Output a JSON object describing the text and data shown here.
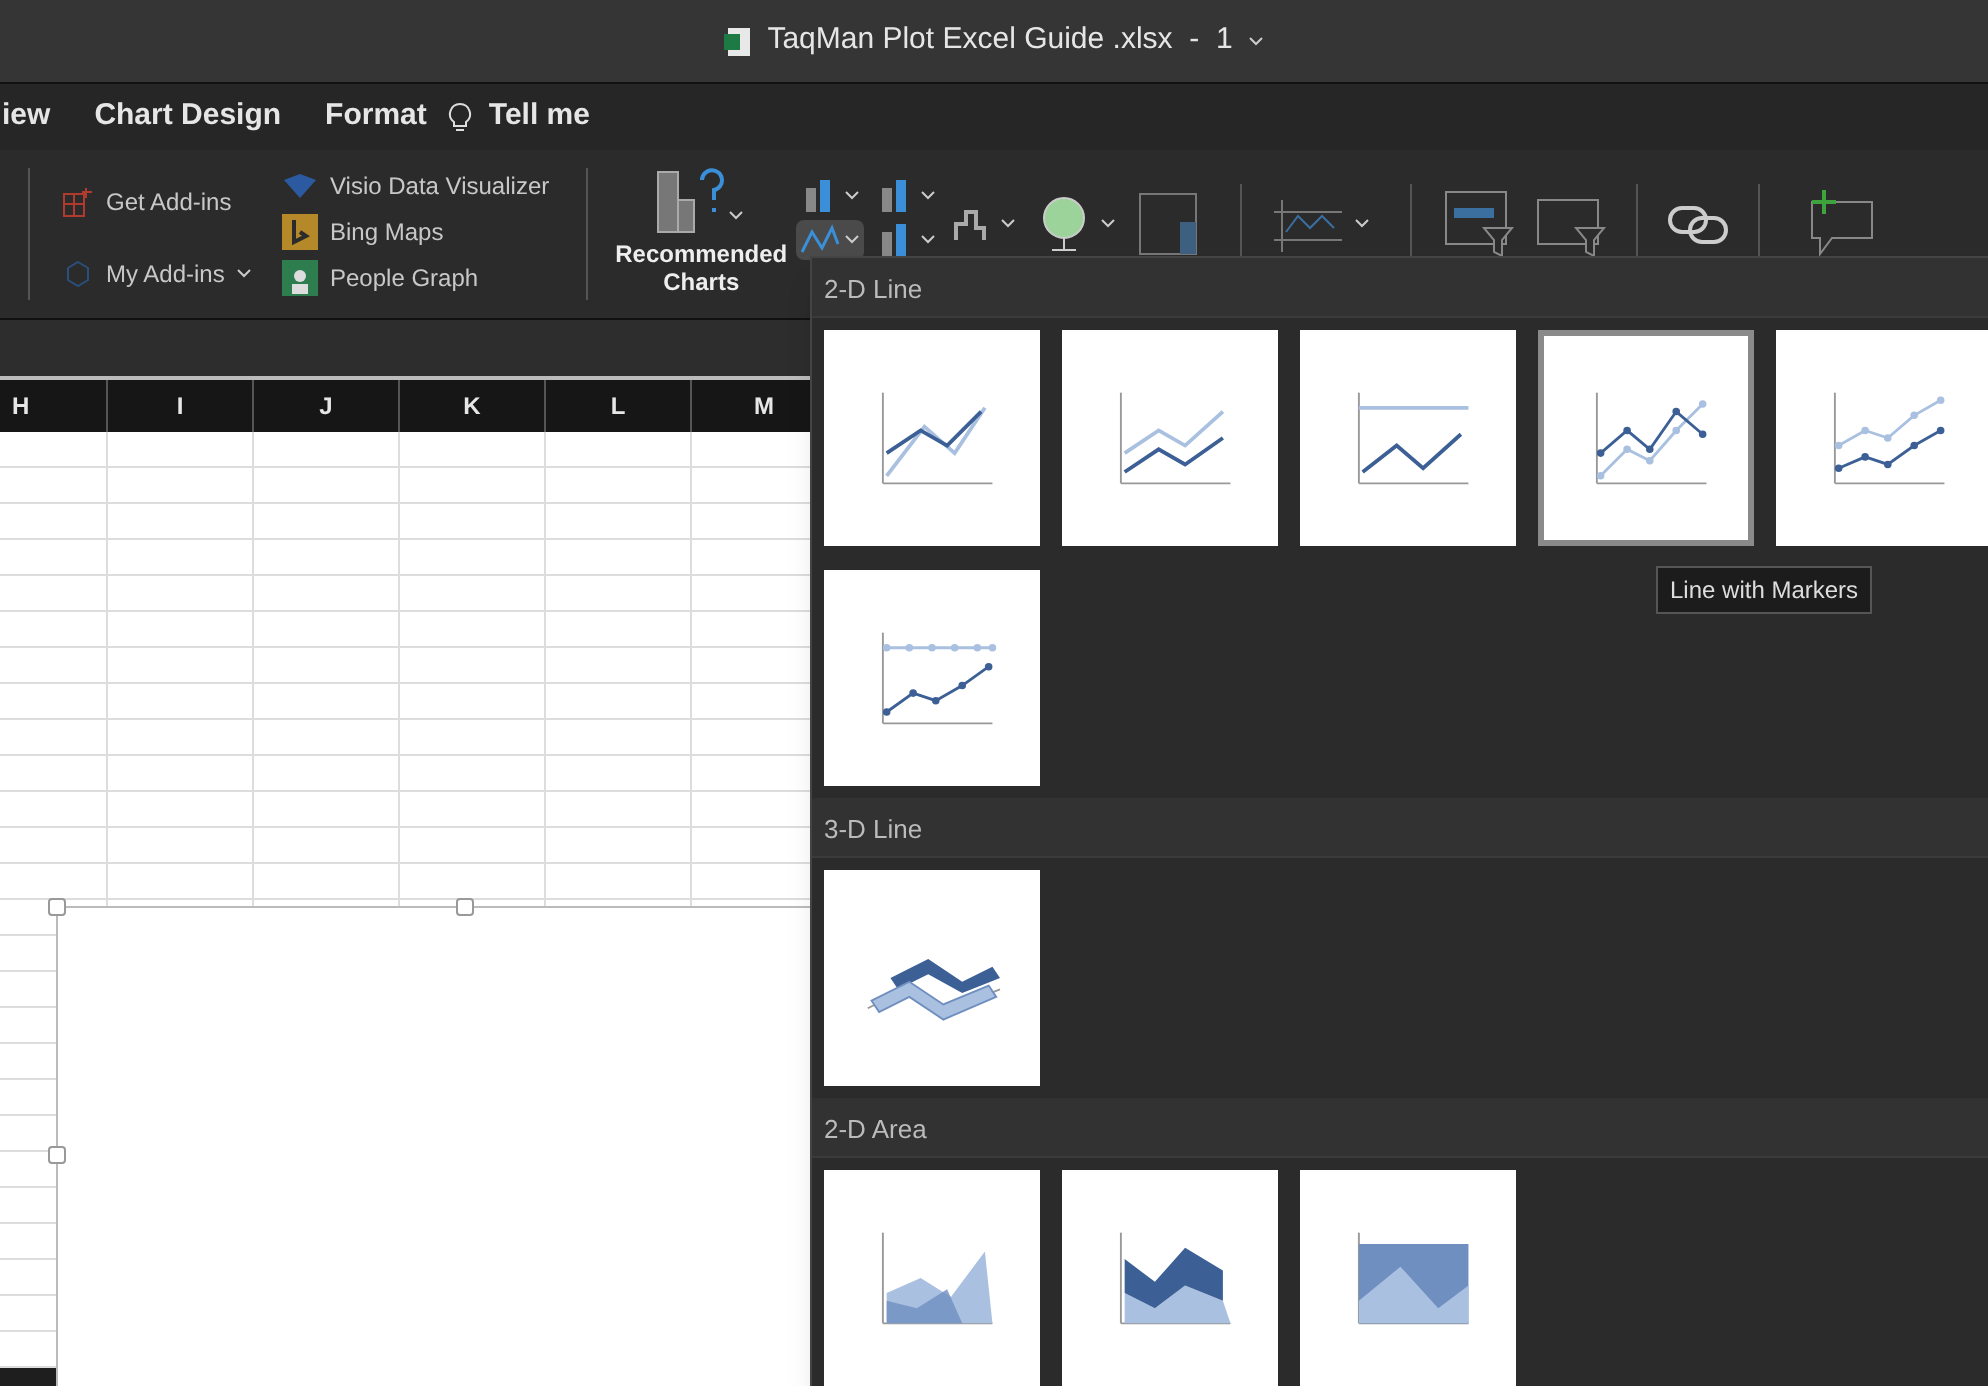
{
  "window": {
    "title": "TaqMan Plot Excel Guide .xlsx  -  1"
  },
  "tabs": [
    {
      "label": "iew",
      "selected": false
    },
    {
      "label": "Chart Design",
      "selected": false
    },
    {
      "label": "Format",
      "selected": false
    }
  ],
  "tell_me": {
    "label": "Tell me"
  },
  "addins": {
    "get": "Get Add-ins",
    "my": "My Add-ins",
    "visio": "Visio Data Visualizer",
    "bing": "Bing Maps",
    "people": "People Graph"
  },
  "recommended": {
    "label": "Recommended Charts"
  },
  "columns": [
    "H",
    "I",
    "J",
    "K",
    "L",
    "M"
  ],
  "gallery": {
    "sections": [
      {
        "title": "2-D Line",
        "items": [
          {
            "kind": "line",
            "selected": false
          },
          {
            "kind": "stacked-line",
            "selected": false
          },
          {
            "kind": "percent-line",
            "selected": false
          },
          {
            "kind": "line-markers",
            "selected": true
          },
          {
            "kind": "stacked-markers",
            "selected": false
          },
          {
            "kind": "percent-markers",
            "selected": false
          }
        ]
      },
      {
        "title": "3-D Line",
        "items": [
          {
            "kind": "line-3d",
            "selected": false
          }
        ]
      },
      {
        "title": "2-D Area",
        "items": [
          {
            "kind": "area",
            "selected": false
          },
          {
            "kind": "stacked-area",
            "selected": false
          },
          {
            "kind": "percent-area",
            "selected": false
          }
        ]
      }
    ]
  },
  "tooltip": "Line with Markers"
}
